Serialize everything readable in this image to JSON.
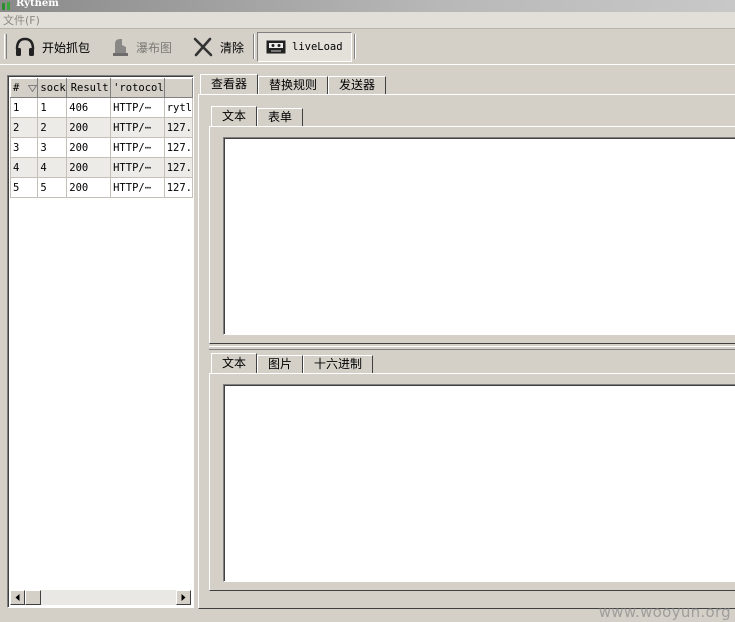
{
  "window": {
    "title": "Rythem"
  },
  "menu": {
    "items": [
      {
        "label": "文件(F)"
      }
    ]
  },
  "toolbar": {
    "buttons": [
      {
        "label": "开始抓包",
        "icon": "headphones-icon",
        "enabled": true
      },
      {
        "label": "瀑布图",
        "icon": "waterfall-icon",
        "enabled": false
      },
      {
        "label": "清除",
        "icon": "clear-x-icon",
        "enabled": true
      },
      {
        "label": "liveLoad",
        "icon": "cassette-icon",
        "enabled": true,
        "pressed": true
      }
    ]
  },
  "session_list": {
    "columns": [
      "#",
      "sock",
      "Result",
      "Protocol",
      ""
    ],
    "column_display": [
      "#",
      "sock",
      "Result",
      "'rotocol",
      ""
    ],
    "rows": [
      [
        "1",
        "1",
        "406",
        "HTTP/⋯",
        "rytl"
      ],
      [
        "2",
        "2",
        "200",
        "HTTP/⋯",
        "127."
      ],
      [
        "3",
        "3",
        "200",
        "HTTP/⋯",
        "127."
      ],
      [
        "4",
        "4",
        "200",
        "HTTP/⋯",
        "127."
      ],
      [
        "5",
        "5",
        "200",
        "HTTP/⋯",
        "127."
      ]
    ]
  },
  "main_tabs": [
    {
      "label": "查看器",
      "active": true
    },
    {
      "label": "替换规则",
      "active": false
    },
    {
      "label": "发送器",
      "active": false
    }
  ],
  "request_tabs": [
    {
      "label": "文本",
      "active": true
    },
    {
      "label": "表单",
      "active": false
    }
  ],
  "response_tabs": [
    {
      "label": "文本",
      "active": true
    },
    {
      "label": "图片",
      "active": false
    },
    {
      "label": "十六进制",
      "active": false
    }
  ],
  "request_text": "",
  "response_text": "",
  "watermark": "www.wooyun.org"
}
